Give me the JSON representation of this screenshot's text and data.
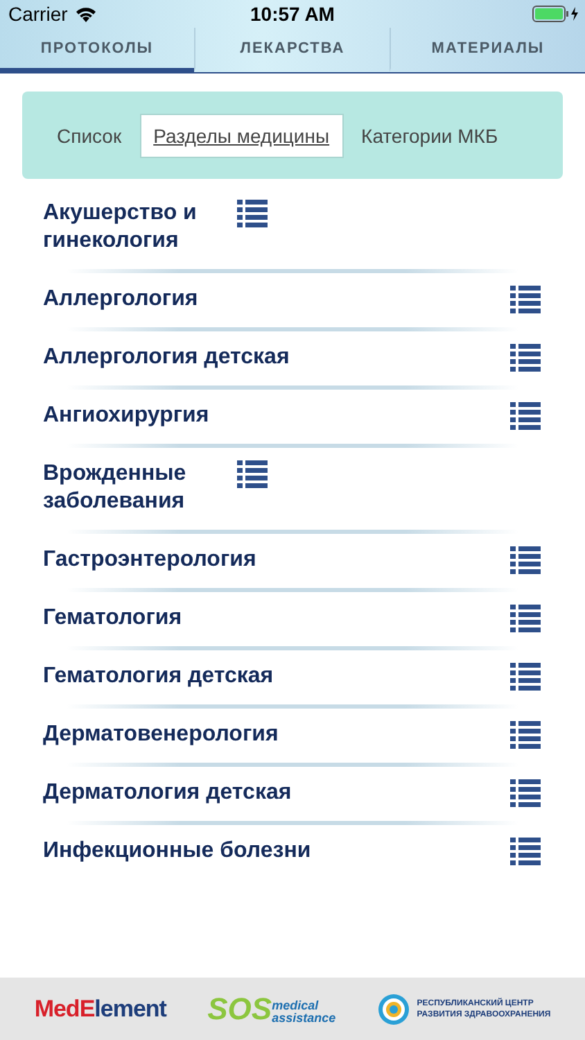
{
  "status_bar": {
    "carrier": "Carrier",
    "time": "10:57 AM"
  },
  "tabs": [
    {
      "label": "ПРОТОКОЛЫ",
      "selected": true
    },
    {
      "label": "ЛЕКАРСТВА",
      "selected": false
    },
    {
      "label": "МАТЕРИАЛЫ",
      "selected": false
    }
  ],
  "segments": [
    {
      "label": "Список",
      "selected": false
    },
    {
      "label": "Разделы медицины",
      "selected": true
    },
    {
      "label": "Категории МКБ",
      "selected": false
    }
  ],
  "sections": [
    {
      "name": "Акушерство и гинекология"
    },
    {
      "name": "Аллергология"
    },
    {
      "name": "Аллергология детская"
    },
    {
      "name": "Ангиохирургия"
    },
    {
      "name": "Врожденные заболевания"
    },
    {
      "name": "Гастроэнтерология"
    },
    {
      "name": "Гематология"
    },
    {
      "name": "Гематология детская"
    },
    {
      "name": "Дерматовенерология"
    },
    {
      "name": "Дерматология детская"
    },
    {
      "name": "Инфекционные болезни"
    }
  ],
  "footer": {
    "logo_1": {
      "part_1": "Med",
      "part_2": "E",
      "part_3": "lement"
    },
    "logo_2": {
      "big": "SOS",
      "small_1": "medical",
      "small_2": "assistance"
    },
    "logo_3": {
      "line_1": "РЕСПУБЛИКАНСКИЙ ЦЕНТР",
      "line_2": "РАЗВИТИЯ ЗДРАВООХРАНЕНИЯ"
    }
  }
}
